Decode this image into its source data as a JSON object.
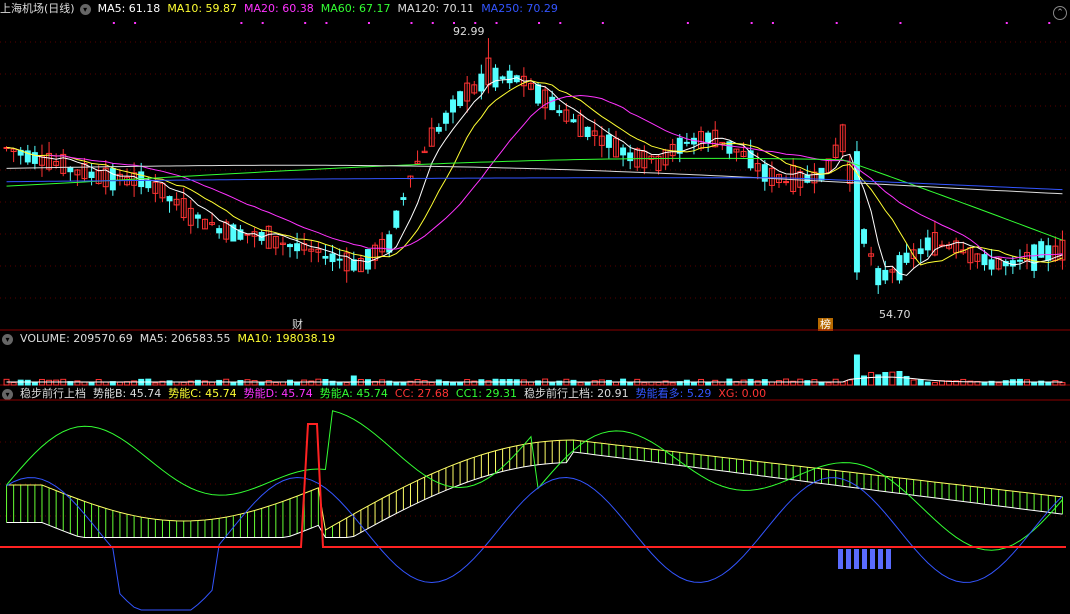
{
  "main_header": {
    "title": "上海机场(日线)",
    "items": [
      {
        "label": "MA5: 61.18",
        "color": "#ffffff"
      },
      {
        "label": "MA10: 59.87",
        "color": "#ffff33"
      },
      {
        "label": "MA20: 60.38",
        "color": "#ff33ff"
      },
      {
        "label": "MA60: 67.17",
        "color": "#33ff33"
      },
      {
        "label": "MA120: 70.11",
        "color": "#dddddd"
      },
      {
        "label": "MA250: 70.29",
        "color": "#3355ff"
      }
    ]
  },
  "volume_header": {
    "items": [
      {
        "label": "VOLUME: 209570.69",
        "color": "#dddddd"
      },
      {
        "label": "MA5: 206583.55",
        "color": "#dddddd"
      },
      {
        "label": "MA10: 198038.19",
        "color": "#ffff33"
      }
    ]
  },
  "ind_header": {
    "items": [
      {
        "label": "稳步前行上档",
        "color": "#dddddd"
      },
      {
        "label": "势能B: 45.74",
        "color": "#dddddd"
      },
      {
        "label": "势能C: 45.74",
        "color": "#ffff33"
      },
      {
        "label": "势能D: 45.74",
        "color": "#ff33ff"
      },
      {
        "label": "势能A: 45.74",
        "color": "#33ff33"
      },
      {
        "label": "CC: 27.68",
        "color": "#ff3333"
      },
      {
        "label": "CC1: 29.31",
        "color": "#33ff33"
      },
      {
        "label": "稳步前行上档: 20.91",
        "color": "#dddddd"
      },
      {
        "label": "势能看多: 5.29",
        "color": "#3355ff"
      },
      {
        "label": "XG: 0.00",
        "color": "#ff3333"
      }
    ]
  },
  "annotations": {
    "high_label": "92.99",
    "low_label": "54.70",
    "tag_cai": "财",
    "tag_bang": "榜"
  },
  "colors": {
    "up": "#ff3333",
    "down": "#54ffff",
    "ma5": "#ffffff",
    "ma10": "#ffff33",
    "ma20": "#ff33ff",
    "ma60": "#33ff33",
    "ma120": "#dddddd",
    "ma250": "#3355ff"
  },
  "chart_data": {
    "type": "candlestick",
    "price_range": [
      52,
      96
    ],
    "high": 92.99,
    "low": 54.7,
    "ohlc_anchors": [
      [
        0,
        77,
        79,
        74,
        76
      ],
      [
        5,
        76,
        77,
        73,
        74
      ],
      [
        10,
        74,
        75,
        71,
        72
      ],
      [
        15,
        73,
        74,
        70,
        71
      ],
      [
        20,
        71,
        73,
        70,
        72
      ],
      [
        26,
        68,
        69,
        64,
        65
      ],
      [
        30,
        65,
        66,
        63,
        64
      ],
      [
        35,
        64,
        65,
        62,
        63
      ],
      [
        40,
        63,
        64,
        60,
        61
      ],
      [
        45,
        62,
        63,
        58,
        59
      ],
      [
        50,
        58,
        61,
        55,
        60
      ],
      [
        54,
        60,
        66,
        59,
        65
      ],
      [
        57,
        72,
        74,
        70,
        73
      ],
      [
        60,
        76,
        81,
        74,
        80
      ],
      [
        64,
        82,
        87,
        81,
        86
      ],
      [
        68,
        86,
        93,
        85,
        88
      ],
      [
        72,
        88,
        92,
        85,
        86
      ],
      [
        76,
        86,
        88,
        80,
        82
      ],
      [
        80,
        82,
        83,
        78,
        79
      ],
      [
        84,
        79,
        80,
        76,
        77
      ],
      [
        88,
        77,
        78,
        73,
        74
      ],
      [
        92,
        74,
        76,
        72,
        75
      ],
      [
        96,
        76,
        80,
        75,
        79
      ],
      [
        100,
        79,
        81,
        76,
        77
      ],
      [
        104,
        77,
        78,
        73,
        74
      ],
      [
        108,
        73,
        74,
        70,
        71
      ],
      [
        112,
        71,
        73,
        70,
        72
      ],
      [
        116,
        72,
        76,
        71,
        75
      ],
      [
        118,
        77,
        86,
        76,
        80
      ],
      [
        120,
        76,
        77,
        61,
        58
      ],
      [
        123,
        58,
        60,
        54.7,
        56
      ],
      [
        126,
        57,
        62,
        56,
        61
      ],
      [
        130,
        61,
        64,
        60,
        63
      ],
      [
        134,
        63,
        65,
        60,
        61
      ],
      [
        138,
        61,
        62,
        57,
        58
      ],
      [
        142,
        58,
        61,
        57,
        60
      ],
      [
        146,
        60,
        63,
        59,
        62
      ],
      [
        149,
        62,
        63,
        59,
        60
      ]
    ],
    "bars": 150,
    "series": [
      {
        "name": "MA5",
        "last": 61.18
      },
      {
        "name": "MA10",
        "last": 59.87
      },
      {
        "name": "MA20",
        "last": 60.38
      },
      {
        "name": "MA60",
        "last": 67.17
      },
      {
        "name": "MA120",
        "last": 70.11
      },
      {
        "name": "MA250",
        "last": 70.29
      }
    ],
    "volume": {
      "last": 209570.69,
      "ma5": 206583.55,
      "ma10": 198038.19
    },
    "indicator": {
      "B": 45.74,
      "C": 45.74,
      "D": 45.74,
      "A": 45.74,
      "CC": 27.68,
      "CC1": 29.31,
      "上档": 20.91,
      "看多": 5.29,
      "XG": 0.0
    }
  }
}
